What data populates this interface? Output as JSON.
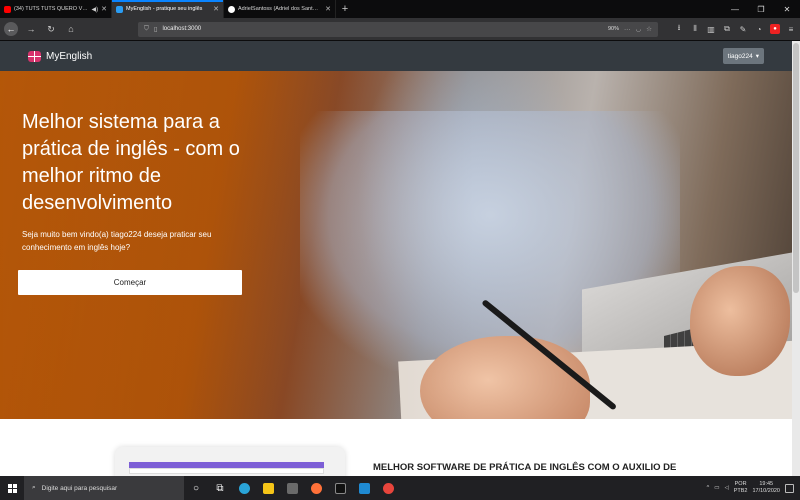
{
  "browser": {
    "tabs": [
      {
        "title": "(34) TUTS TUTS QUERO VE…",
        "favicon_color": "#ff0000",
        "active": false,
        "audio": true
      },
      {
        "title": "MyEnglish - pratique seu inglês",
        "favicon_color": "#2a9df4",
        "active": true,
        "audio": false
      },
      {
        "title": "AdrielSantoss (Adriel dos Sant…",
        "favicon_color": "#ffffff",
        "active": false,
        "audio": false
      }
    ],
    "new_tab_symbol": "+",
    "url": "localhost:3000",
    "zoom": "90%"
  },
  "site": {
    "brand": "MyEnglish",
    "user_menu": "tiago224",
    "hero": {
      "title": "Melhor sistema para a prática de inglês - com o melhor ritmo de desenvolvimento",
      "subtitle": "Seja muito bem vindo(a) tiago224 deseja praticar seu conhecimento em inglês hoje?",
      "cta": "Começar"
    },
    "feature_heading": "MELHOR SOFTWARE DE PRÁTICA DE INGLÊS COM O AUXILIO DE"
  },
  "taskbar": {
    "search_placeholder": "Digite aqui para pesquisar",
    "lang_line1": "POR",
    "lang_line2": "PTB2",
    "time": "19:45",
    "date": "17/10/2020"
  },
  "colors": {
    "site_nav": "#343a40",
    "brand_logo": "#d6336c",
    "user_menu": "#6c757d",
    "tab_active_accent": "#0a84ff"
  }
}
